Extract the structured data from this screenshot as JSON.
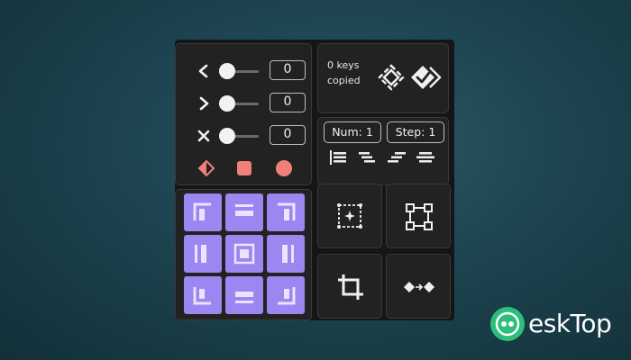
{
  "sliders": [
    {
      "icon": "chevron-left-icon",
      "value": "0"
    },
    {
      "icon": "chevron-right-icon",
      "value": "0"
    },
    {
      "icon": "close-icon",
      "value": "0"
    }
  ],
  "color_buttons": [
    "#f08079",
    "#f08079",
    "#f08079"
  ],
  "keys": {
    "line1": "0 keys",
    "line2": "copied"
  },
  "num": {
    "label": "Num: 1"
  },
  "step": {
    "label": "Step: 1"
  },
  "accent": "#9b86f2",
  "watermark": {
    "text": "eskTop"
  }
}
